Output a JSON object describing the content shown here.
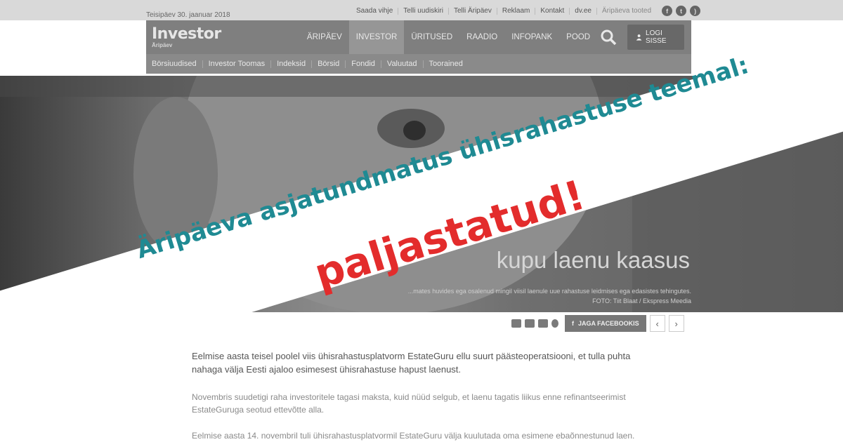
{
  "topbar": {
    "date": "Teisipäev 30. jaanuar 2018",
    "links": [
      "Saada vihje",
      "Telli uudiskiri",
      "Telli Äripäev",
      "Reklaam",
      "Kontakt",
      "dv.ee",
      "Äripäeva tooted"
    ],
    "social_icons": [
      "facebook-icon",
      "twitter-icon",
      "rss-icon"
    ]
  },
  "header": {
    "logo_main": "Investor",
    "logo_sub": "Äripäev",
    "nav": [
      "ÄRIPÄEV",
      "INVESTOR",
      "ÜRITUSED",
      "RAADIO",
      "INFOPANK",
      "POOD"
    ],
    "active_nav": "INVESTOR",
    "login_label": "LOGI SISSE"
  },
  "subnav": [
    "Börsiuudised",
    "Investor Toomas",
    "Indeksid",
    "Börsid",
    "Fondid",
    "Valuutad",
    "Toorained"
  ],
  "article": {
    "headline_visible": "kupu laenu kaasus",
    "caption": "...mates huvides ega osalenud mingil viisil laenule uue rahastuse leidmises ega edasistes tehingutes.",
    "photo_credit": "FOTO: Tiit Blaat / Ekspress Meedia",
    "share_label": "JAGA FACEBOOKIS",
    "lead": "Eelmise aasta teisel poolel viis ühisrahastusplatvorm EstateGuru ellu suurt päästeoperatsiooni, et tulla puhta nahaga välja Eesti ajaloo esimesest ühisrahastuse hapust laenust.",
    "para1": "Novembris suudetigi raha investoritele tagasi maksta, kuid nüüd selgub, et laenu tagatis liikus enne refinantseerimist EstateGuruga seotud ettevõtte alla.",
    "para2": "Eelmise aasta 14. novembril tuli ühisrahastusplatvormil EstateGuru välja kuulutada oma esimene ebaõnnestunud laen."
  },
  "banner": {
    "line1": "Äripäeva asjatundmatus ühisrahastuse teemal:",
    "line2": "paljastatud!",
    "line1_color": "#1f8a93",
    "line2_color": "#e32c2c"
  }
}
